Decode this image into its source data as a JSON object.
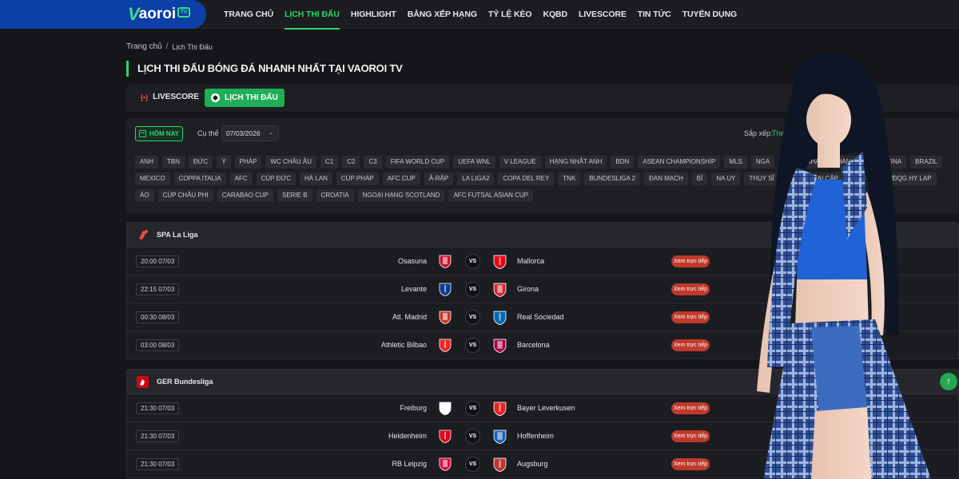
{
  "header": {
    "logo_text": "aoroi",
    "logo_badge": "TV",
    "nav": [
      "TRANG CHỦ",
      "LỊCH THI ĐẤU",
      "HIGHLIGHT",
      "BẢNG XẾP HẠNG",
      "TỶ LỆ KÈO",
      "KQBD",
      "LIVESCORE",
      "TIN TỨC",
      "TUYỂN DỤNG"
    ],
    "active_nav": "LỊCH THI ĐẤU"
  },
  "breadcrumb": {
    "home": "Trang chủ",
    "sep": "/",
    "current": "Lịch Thi Đấu"
  },
  "page_title": "LỊCH THI ĐẤU BÓNG ĐÁ NHANH NHẤT TẠI VAOROI TV",
  "tabs": {
    "livescore_icon": "(•)",
    "livescore": "LIVESCORE",
    "schedule": "LỊCH THI ĐẤU"
  },
  "filters": {
    "today": "HÔM NAY",
    "date_label": "Cụ thể",
    "date_value": "07/03/2026",
    "sort_label": "Sắp xếp:",
    "sort_value": "The",
    "chips": [
      "ANH",
      "TBN",
      "ĐỨC",
      "Ý",
      "PHÁP",
      "WC CHÂU ÂU",
      "C1",
      "C2",
      "C3",
      "FIFA WORLD CUP",
      "UEFA WNL",
      "V LEAGUE",
      "HẠNG NHẤT ANH",
      "BDN",
      "ASEAN CHAMPIONSHIP",
      "MLS",
      "NGA",
      "ÚC",
      "NHẬT",
      "HÀN",
      "ARGENTINA",
      "BRAZIL",
      "MEXICO",
      "COPPA ITALIA",
      "AFC",
      "CÚP ĐỨC",
      "HÀ LAN",
      "CÚP PHÁP",
      "AFC CUP",
      "Ả-RẬP",
      "LA LIGA2",
      "COPA DEL REY",
      "TNK",
      "BUNDESLIGA 2",
      "ĐAN MẠCH",
      "BỈ",
      "NA UY",
      "THỤY SĨ",
      "INDO",
      "AI CẬP",
      "FA CUP",
      "VĐQG HY LẠP",
      "ÁO",
      "CÚP CHÂU PHI",
      "CARABAO CUP",
      "SERIE B",
      "CROATIA",
      "NGOẠI HẠNG SCOTLAND",
      "AFC FUTSAL ASIAN CUP"
    ]
  },
  "leagues": [
    {
      "name": "SPA La Liga",
      "logo": "laliga-icon",
      "matches": [
        {
          "time": "20:00 07/03",
          "home": "Osasuna",
          "away": "Mallorca",
          "home_color": "#c8102e",
          "away_color": "#e20613"
        },
        {
          "time": "22:15 07/03",
          "home": "Levante",
          "away": "Girona",
          "home_color": "#0b3d91",
          "away_color": "#cd2534"
        },
        {
          "time": "00:30 08/03",
          "home": "Atl. Madrid",
          "away": "Real Sociedad",
          "home_color": "#cb3524",
          "away_color": "#0067b1"
        },
        {
          "time": "03:00 08/03",
          "home": "Athletic Bilbao",
          "away": "Barcelona",
          "home_color": "#ee2523",
          "away_color": "#a50044"
        }
      ]
    },
    {
      "name": "GER Bundesliga",
      "logo": "bundesliga-icon",
      "matches": [
        {
          "time": "21:30 07/03",
          "home": "Freiburg",
          "away": "Bayer Leverkusen",
          "home_color": "#ffffff",
          "away_color": "#e32221"
        },
        {
          "time": "21:30 07/03",
          "home": "Heidenheim",
          "away": "Hoffenheim",
          "home_color": "#e2001a",
          "away_color": "#1961b5"
        },
        {
          "time": "21:30 07/03",
          "home": "RB Leipzig",
          "away": "Augsburg",
          "home_color": "#dd0741",
          "away_color": "#ba3733"
        }
      ]
    }
  ],
  "watch_label": "Xem trực tiếp",
  "vs_label": "VS",
  "scroll_top_icon": "↑",
  "colors": {
    "accent": "#2fd36e",
    "brand": "#0d3fa8",
    "live_button": "#c0392b"
  }
}
